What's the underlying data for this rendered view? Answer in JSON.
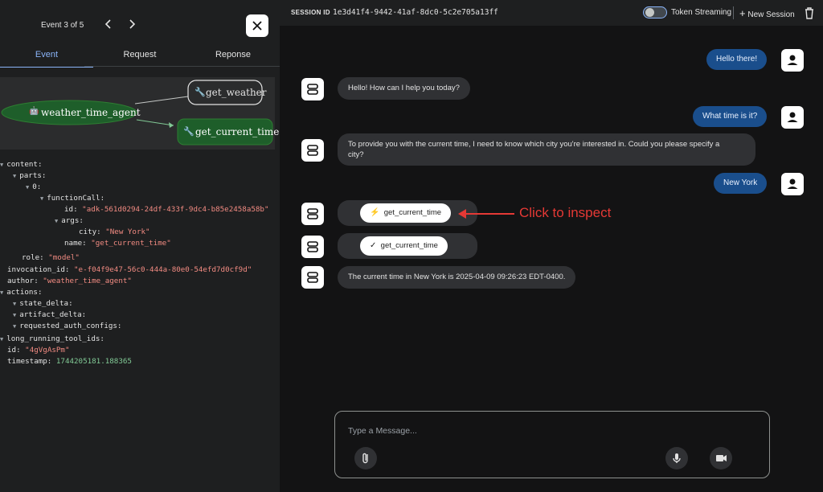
{
  "event_panel": {
    "counter": "Event 3 of 5",
    "prev_icon": "chevron-left-icon",
    "next_icon": "chevron-right-icon",
    "close_icon": "close-icon",
    "tabs": [
      "Event",
      "Request",
      "Reponse"
    ],
    "active_tab": "Event"
  },
  "graph": {
    "agent_node": "weather_time_agent",
    "tool_nodes": [
      "get_weather",
      "get_current_time"
    ],
    "active_tool": "get_current_time",
    "agent_color": "#1e5e2a"
  },
  "event_tree": {
    "content_key": "content:",
    "parts_key": "parts:",
    "index_key": "0:",
    "function_call_key": "functionCall:",
    "id_key": "id:",
    "id_value": "\"adk-561d0294-24df-433f-9dc4-b85e2458a58b\"",
    "args_key": "args:",
    "city_key": "city:",
    "city_value": "\"New York\"",
    "name_key": "name:",
    "name_value": "\"get_current_time\"",
    "role_key": "role:",
    "role_value": "\"model\"",
    "invocation_key": "invocation_id:",
    "invocation_value": "\"e-f04f9e47-56c0-444a-80e0-54efd7d0cf9d\"",
    "author_key": "author:",
    "author_value": "\"weather_time_agent\"",
    "actions_key": "actions:",
    "state_delta_key": "state_delta:",
    "artifact_delta_key": "artifact_delta:",
    "requested_auth_key": "requested_auth_configs:",
    "long_running_key": "long_running_tool_ids:",
    "event_id_key": "id:",
    "event_id_value": "\"4gVgAsPm\"",
    "timestamp_key": "timestamp:",
    "timestamp_value": "1744205181.188365"
  },
  "topbar": {
    "session_label": "SESSION ID",
    "session_id": "1e3d41f4-9442-41af-8dc0-5c2e705a13ff",
    "streaming_label": "Token Streaming",
    "streaming_on": false,
    "new_session_label": "New Session",
    "delete_icon": "trash-icon"
  },
  "chat": {
    "user_msg_1": "Hello there!",
    "bot_msg_1": "Hello! How can I help you today?",
    "user_msg_2": "What time is it?",
    "bot_msg_2_line1": "To provide you with the current time, I need to know which city you're interested in. Could you please specify a",
    "bot_msg_2_line2": "city?",
    "user_msg_3": "New York",
    "tool_call_label": "get_current_time",
    "tool_call_icon": "bolt-icon",
    "tool_result_label": "get_current_time",
    "tool_result_icon": "check-icon",
    "bot_msg_3": "The current time in New York is 2025-04-09 09:26:23 EDT-0400."
  },
  "annotation": {
    "text": "Click to inspect",
    "color": "#e53935"
  },
  "composer": {
    "placeholder": "Type a Message...",
    "attach_icon": "paperclip-icon",
    "mic_icon": "microphone-icon",
    "video_icon": "video-camera-icon"
  }
}
